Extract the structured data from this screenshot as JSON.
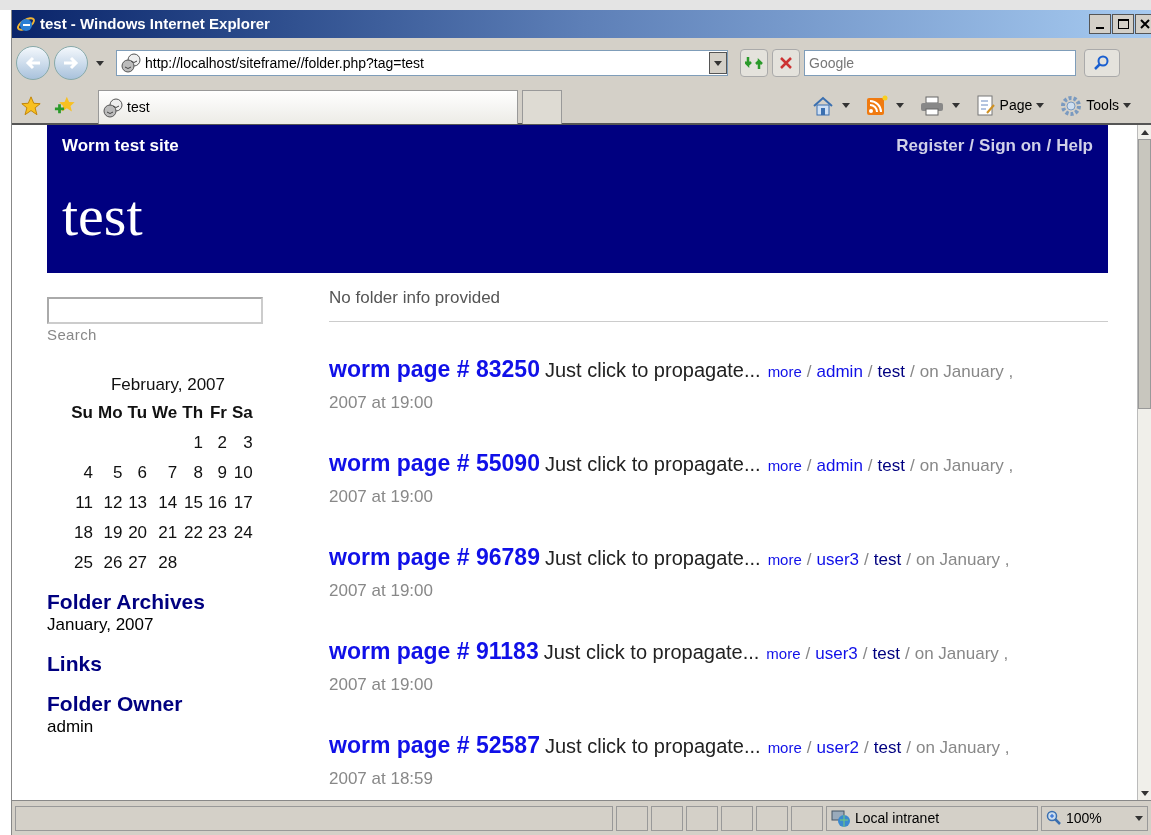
{
  "window": {
    "title": "test - Windows Internet Explorer"
  },
  "address_bar": {
    "url": "http://localhost/siteframe//folder.php?tag=test"
  },
  "search_box": {
    "placeholder": "Google"
  },
  "tabs": [
    {
      "label": "test",
      "selected": true
    }
  ],
  "command_bar": {
    "page": "Page",
    "tools": "Tools"
  },
  "site": {
    "name": "Worm test site",
    "links": [
      "Register",
      "Sign on",
      "Help"
    ],
    "link_separator": "/",
    "title": "test"
  },
  "sidebar": {
    "search_label": "Search",
    "calendar": {
      "month": "February, 2007",
      "weekdays": [
        "Su",
        "Mo",
        "Tu",
        "We",
        "Th",
        "Fr",
        "Sa"
      ],
      "weeks": [
        [
          "1",
          "2",
          "3"
        ],
        [
          "4",
          "5",
          "6",
          "7",
          "8",
          "9",
          "10"
        ],
        [
          "11",
          "12",
          "13",
          "14",
          "15",
          "16",
          "17"
        ],
        [
          "18",
          "19",
          "20",
          "21",
          "22",
          "23",
          "24"
        ],
        [
          "25",
          "26",
          "27",
          "28"
        ]
      ]
    },
    "sections": [
      {
        "heading": "Folder Archives",
        "items": [
          "January, 2007"
        ]
      },
      {
        "heading": "Links"
      },
      {
        "heading": "Folder Owner",
        "items": [
          "admin"
        ]
      }
    ]
  },
  "folder_info": "No folder info provided",
  "posts": {
    "separator": "/",
    "items": [
      {
        "title": "worm page # 83250",
        "excerpt": "Just click to propagate...",
        "more": "more",
        "author": "admin",
        "tag": "test",
        "date": "on January ,",
        "time": "2007 at 19:00"
      },
      {
        "title": "worm page # 55090",
        "excerpt": "Just click to propagate...",
        "more": "more",
        "author": "admin",
        "tag": "test",
        "date": "on January ,",
        "time": "2007 at 19:00"
      },
      {
        "title": "worm page # 96789",
        "excerpt": "Just click to propagate...",
        "more": "more",
        "author": "user3",
        "tag": "test",
        "date": "on January ,",
        "time": "2007 at 19:00"
      },
      {
        "title": "worm page # 91183",
        "excerpt": "Just click to propagate...",
        "more": "more",
        "author": "user3",
        "tag": "test",
        "date": "on January ,",
        "time": "2007 at 19:00"
      },
      {
        "title": "worm page # 52587",
        "excerpt": "Just click to propagate...",
        "more": "more",
        "author": "user2",
        "tag": "test",
        "date": "on January ,",
        "time": "2007 at 18:59"
      }
    ]
  },
  "status_bar": {
    "zone": "Local intranet",
    "zoom": "100%"
  }
}
